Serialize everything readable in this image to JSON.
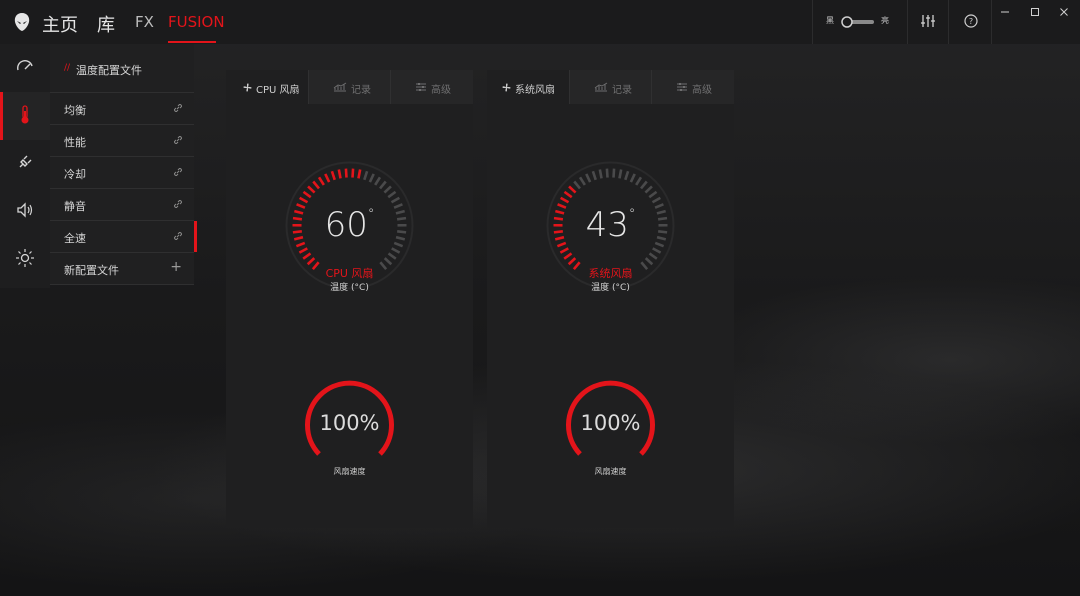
{
  "titlebar": {
    "nav": {
      "home": "主页",
      "library": "库",
      "fx": "FX",
      "fusion": "FUSION"
    },
    "toggle": {
      "left_label": "黑",
      "right_label": "亮"
    },
    "window_controls": [
      "minimize-icon",
      "maximize-icon",
      "close-icon"
    ]
  },
  "iconbar": {
    "items": [
      "performance-gauge-icon",
      "thermometer-icon",
      "power-plug-icon",
      "speaker-icon",
      "brightness-icon"
    ],
    "active_index": 1
  },
  "profiles": {
    "title": "温度配置文件",
    "items": [
      {
        "label": "均衡",
        "active": false
      },
      {
        "label": "性能",
        "active": false
      },
      {
        "label": "冷却",
        "active": false
      },
      {
        "label": "静音",
        "active": false
      },
      {
        "label": "全速",
        "active": true
      }
    ],
    "new_profile": "新配置文件"
  },
  "cards": [
    {
      "tabs": [
        "CPU 风扇",
        "记录",
        "高级"
      ],
      "temperature": "60",
      "degree": "°",
      "fan_name": "CPU 风扇",
      "temp_unit": "温度 (°C)",
      "temp_fraction": 0.55,
      "speed": "100%",
      "speed_label": "风扇速度"
    },
    {
      "tabs": [
        "系统风扇",
        "记录",
        "高级"
      ],
      "temperature": "43",
      "degree": "°",
      "fan_name": "系统风扇",
      "temp_unit": "温度 (°C)",
      "temp_fraction": 0.35,
      "speed": "100%",
      "speed_label": "风扇速度"
    }
  ],
  "colors": {
    "accent": "#e3141a",
    "tick_inactive": "#4a4a4b",
    "panel": "#1f1f20"
  }
}
